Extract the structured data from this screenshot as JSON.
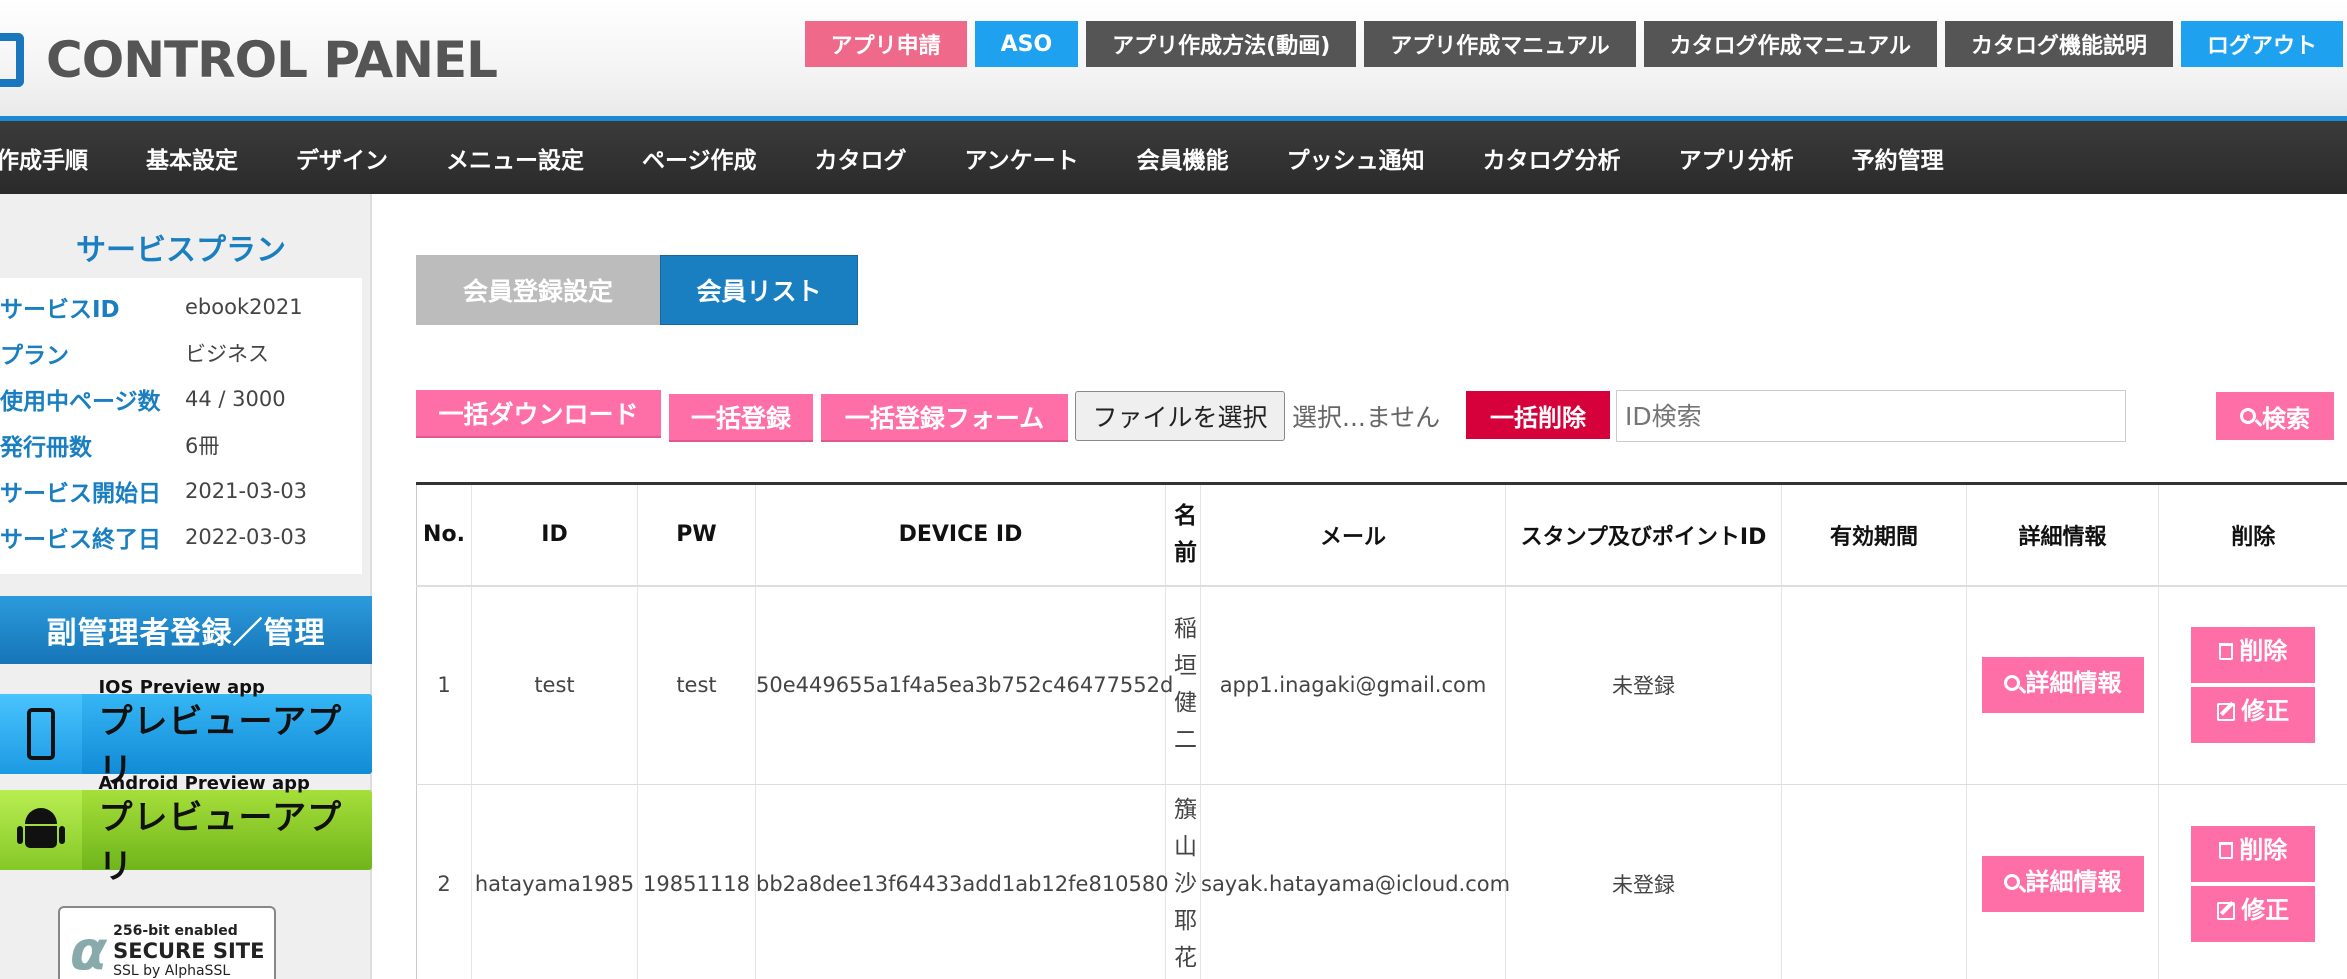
{
  "header": {
    "logo_text": "CONTROL PANEL",
    "buttons": [
      "アプリ申請",
      "ASO",
      "アプリ作成方法(動画)",
      "アプリ作成マニュアル",
      "カタログ作成マニュアル",
      "カタログ機能説明",
      "ログアウト"
    ]
  },
  "nav": {
    "items": [
      "作成手順",
      "基本設定",
      "デザイン",
      "メニュー設定",
      "ページ作成",
      "カタログ",
      "アンケート",
      "会員機能",
      "プッシュ通知",
      "カタログ分析",
      "アプリ分析",
      "予約管理"
    ]
  },
  "sidebar": {
    "plan_title": "サービスプラン",
    "rows": [
      {
        "label": "サービスID",
        "value": "ebook2021"
      },
      {
        "label": "プラン",
        "value": "ビジネス"
      },
      {
        "label": "使用中ページ数",
        "value": "44 / 3000"
      },
      {
        "label": "発行冊数",
        "value": "6冊"
      },
      {
        "label": "サービス開始日",
        "value": "2021-03-03"
      },
      {
        "label": "サービス終了日",
        "value": "2022-03-03"
      }
    ],
    "sub_admin": "副管理者登録／管理",
    "ios_preview": {
      "small": "IOS Preview app",
      "big": "プレビューアプリ"
    },
    "android_preview": {
      "small": "Android Preview app",
      "big": "プレビューアプリ"
    },
    "secure": {
      "line1": "256-bit enabled",
      "line2": "SECURE SITE",
      "line3": "SSL by AlphaSSL"
    }
  },
  "tabs": {
    "register": "会員登録設定",
    "list": "会員リスト"
  },
  "toolbar": {
    "bulk_download": "一括ダウンロード",
    "bulk_register": "一括登録",
    "bulk_register_form": "一括登録フォーム",
    "choose_file": "ファイルを選択",
    "file_status": "選択...ません",
    "bulk_delete": "一括削除",
    "search_placeholder": "ID検索",
    "search": "検索"
  },
  "table": {
    "headers": [
      "No.",
      "ID",
      "PW",
      "DEVICE ID",
      "名前",
      "メール",
      "スタンプ及びポイントID",
      "有効期間",
      "詳細情報",
      "削除"
    ],
    "rows": [
      {
        "no": "1",
        "id": "test",
        "pw": "test",
        "device_id": "50e449655a1f4a5ea3b752c46477552d",
        "name": "稲垣健二",
        "mail": "app1.inagaki@gmail.com",
        "stamp": "未登録",
        "period": "",
        "detail": "詳細情報",
        "delete": "削除",
        "edit": "修正"
      },
      {
        "no": "2",
        "id": "hatayama1985",
        "pw": "19851118",
        "device_id": "bb2a8dee13f64433add1ab12fe810580",
        "name": "籏山沙耶花",
        "mail": "sayak.hatayama@icloud.com",
        "stamp": "未登録",
        "period": "",
        "detail": "詳細情報",
        "delete": "削除",
        "edit": "修正"
      }
    ]
  }
}
